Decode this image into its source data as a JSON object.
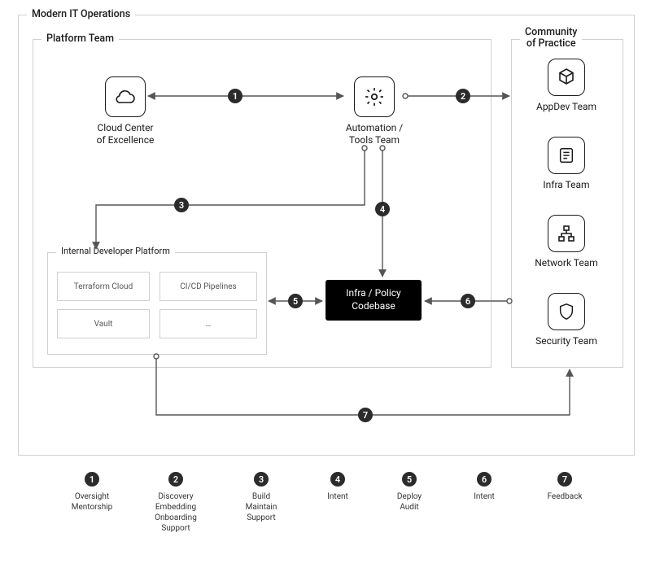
{
  "title": "Modern IT Operations",
  "platform_team": {
    "label": "Platform Team",
    "cloud_center": "Cloud Center\nof Excellence",
    "automation": "Automation /\nTools Team"
  },
  "idp": {
    "label": "Internal Developer Platform",
    "cards": [
      "Terraform Cloud",
      "CI/CD Pipelines",
      "Vault",
      "…"
    ]
  },
  "codebase": "Infra / Policy\nCodebase",
  "community": {
    "label": "Community\nof Practice",
    "teams": [
      "AppDev Team",
      "Infra Team",
      "Network Team",
      "Security Team"
    ]
  },
  "edges": [
    {
      "n": "1",
      "desc": "Oversight\nMentorship"
    },
    {
      "n": "2",
      "desc": "Discovery\nEmbedding\nOnboarding\nSupport"
    },
    {
      "n": "3",
      "desc": "Build\nMaintain\nSupport"
    },
    {
      "n": "4",
      "desc": "Intent"
    },
    {
      "n": "5",
      "desc": "Deploy\nAudit"
    },
    {
      "n": "6",
      "desc": "Intent"
    },
    {
      "n": "7",
      "desc": "Feedback"
    }
  ],
  "colors": {
    "ink": "#1a1a1a",
    "muted": "#d0d0d0",
    "bubble": "#2b2b2b"
  }
}
